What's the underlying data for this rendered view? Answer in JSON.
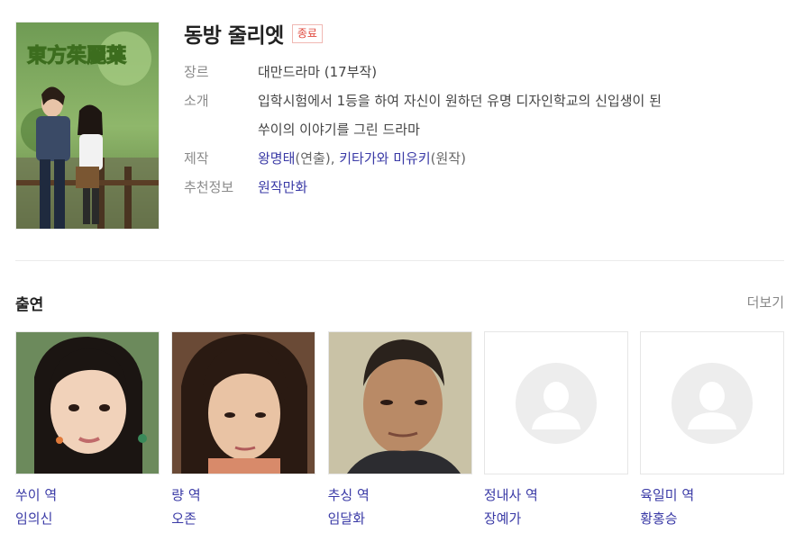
{
  "show": {
    "title": "동방 줄리엣",
    "status": "종료",
    "poster_logo_text": "東方茱麗葉"
  },
  "info": {
    "genre_label": "장르",
    "genre_value": "대만드라마 (17부작)",
    "intro_label": "소개",
    "intro_line1": "입학시험에서 1등을 하여 자신이 원하던 유명 디자인학교의 신입생이 된",
    "intro_line2": "쑤이의 이야기를 그린 드라마",
    "production_label": "제작",
    "director": "왕명태",
    "director_role": "(연출), ",
    "author": "키타가와 미유키",
    "author_role": "(원작)",
    "recommend_label": "추천정보",
    "recommend_value": "원작만화"
  },
  "cast_section": {
    "title": "출연",
    "more": "더보기",
    "members": [
      {
        "role": "쑤이 역",
        "name": "임의신",
        "photo": "actress-photo"
      },
      {
        "role": "량 역",
        "name": "오존",
        "photo": "actor-photo"
      },
      {
        "role": "추싱 역",
        "name": "임달화",
        "photo": "actor-photo"
      },
      {
        "role": "정내사 역",
        "name": "장예가",
        "photo": "default-profile-icon"
      },
      {
        "role": "육일미 역",
        "name": "황홍승",
        "photo": "default-profile-icon"
      }
    ]
  },
  "colors": {
    "link": "#3a3aa6",
    "status_badge": "#e04a3f",
    "label": "#8a8a8a"
  }
}
